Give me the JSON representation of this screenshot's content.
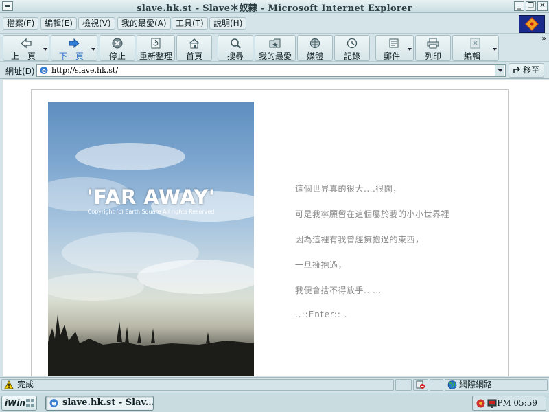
{
  "window": {
    "title": "slave.hk.st - Slave＊奴隸 - Microsoft Internet Explorer",
    "controls": [
      "minimize",
      "restore",
      "close"
    ]
  },
  "menu": [
    "檔案(F)",
    "編輯(E)",
    "檢視(V)",
    "我的最愛(A)",
    "工具(T)",
    "說明(H)"
  ],
  "toolbar": {
    "back": "上一頁",
    "forward": "下一頁",
    "stop": "停止",
    "refresh": "重新整理",
    "home": "首頁",
    "search": "搜尋",
    "favorites": "我的最愛",
    "media": "媒體",
    "history": "記錄",
    "mail": "郵件",
    "print": "列印",
    "edit": "編輯",
    "more": "»"
  },
  "address": {
    "label": "網址(D)",
    "url": "http://slave.hk.st/",
    "go": "移至"
  },
  "page": {
    "image_title": "'FAR AWAY'",
    "image_subtitle": "Copyright (c) Earth Square All rights Reserved",
    "lines": [
      "這個世界真的很大....很闊，",
      "可是我寧願留在這個屬於我的小小世界裡",
      "因為這裡有我曾經擁抱過的東西，",
      "一旦擁抱過，",
      "我便會捨不得放手......"
    ],
    "enter": "..::Enter::.."
  },
  "status": {
    "text": "完成",
    "zone": "網際網路"
  },
  "taskbar": {
    "start": "iWin",
    "task": "slave.hk.st - Slav...",
    "clock": "PM 05:59"
  }
}
